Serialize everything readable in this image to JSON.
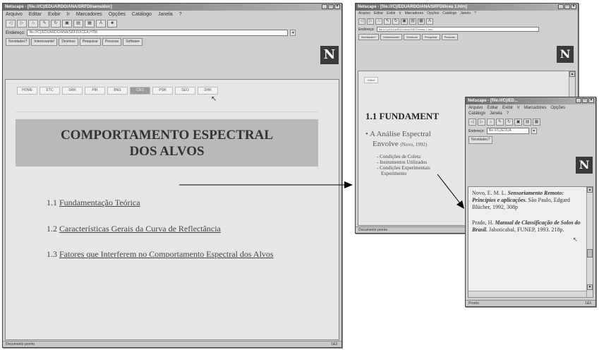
{
  "main_window": {
    "title": "Netscape - [file:///C|/EDUARDO/ANA/SRFDI/sensidoc]",
    "menu": [
      "Arquivo",
      "Editar",
      "Exibir",
      "Ir",
      "Marcadores",
      "Opções",
      "Catálogo",
      "Janela",
      "?"
    ],
    "toolbar_icons": [
      "back-icon",
      "forward-icon",
      "home-icon",
      "edit-icon",
      "reload-icon",
      "images-icon",
      "open-icon",
      "print-icon",
      "find-icon",
      "stop-icon"
    ],
    "location_label": "Endereço:",
    "location_value": "file:///C|/EDUARDO/ANA/SRFDI/ICEA.HTM",
    "nav_buttons": [
      "Novidades?",
      "Interessante!",
      "Destinos",
      "Pesquisar",
      "Pessoas",
      "Software"
    ],
    "tabs": [
      "HOME",
      "ETC",
      "SRR",
      "PIR",
      "BNS",
      "CRS",
      "PSR",
      "SEO",
      "SHR"
    ],
    "active_tab": 5,
    "banner_line1": "COMPORTAMENTO ESPECTRAL",
    "banner_line2": "DOS ALVOS",
    "toc": [
      {
        "num": "1.1",
        "text": "Fundamentação Teórica"
      },
      {
        "num": "1.2",
        "text": "Características Gerais da Curva de Reflectância"
      },
      {
        "num": "1.3",
        "text": "Fatores que Interferem no Comportamento Espectral dos Alvos"
      }
    ],
    "status": "Documento pronto",
    "status_right": "1&3"
  },
  "second_window": {
    "title": "Netscape - [file:///C|/EDUARDO/ANA/SRFDI/icea 1.htm]",
    "menu": [
      "Arquivo",
      "Editar",
      "Exibir",
      "Ir",
      "Marcadores",
      "Opções",
      "Catálogo",
      "Janela",
      "?"
    ],
    "location_label": "Endereço:",
    "location_value": "file:///C|/EDUARDO/ANA/SRFDI/icea 1.htm",
    "nav_buttons": [
      "Novidades?",
      "Interessante!",
      "Destinos",
      "Pesquisar",
      "Pessoas"
    ],
    "home_tab": "Voltar",
    "heading": "1.1 FUNDAMENT",
    "bullet": "• A Análise Espectral",
    "bullet_cont": "Envolve",
    "bullet_ref": "(Novo, 1992)",
    "sub_items": [
      "- Condições de Coleta",
      "- Instrumentos Utilizados",
      "- Condições Experimentais",
      "Experimento"
    ],
    "status": "Documento pronto"
  },
  "third_window": {
    "title": "Netscape - [file:///C|/ED...",
    "menu": [
      "Arquivo",
      "Editar",
      "Exibir",
      "Ir",
      "Marcadores",
      "Opções",
      "Catálogo",
      "Janela",
      "?"
    ],
    "location_label": "Endereço:",
    "location_value": "file:///C|/EDUA",
    "nav_buttons": [
      "Novidades?"
    ],
    "ref1_author": "Novo, E. M. L.",
    "ref1_title": "Sensoriamento Remoto: Princípios e aplicações.",
    "ref1_rest": "São Paulo, Edgard Blücher, 1992, 308p",
    "ref2_author": "Prado, H.",
    "ref2_title": "Manual de Classificação de Solos do Brasil.",
    "ref2_rest": "Jaboticabal, FUNEP, 1993. 218p.",
    "status": "Pronto",
    "status_right": "1&3"
  }
}
